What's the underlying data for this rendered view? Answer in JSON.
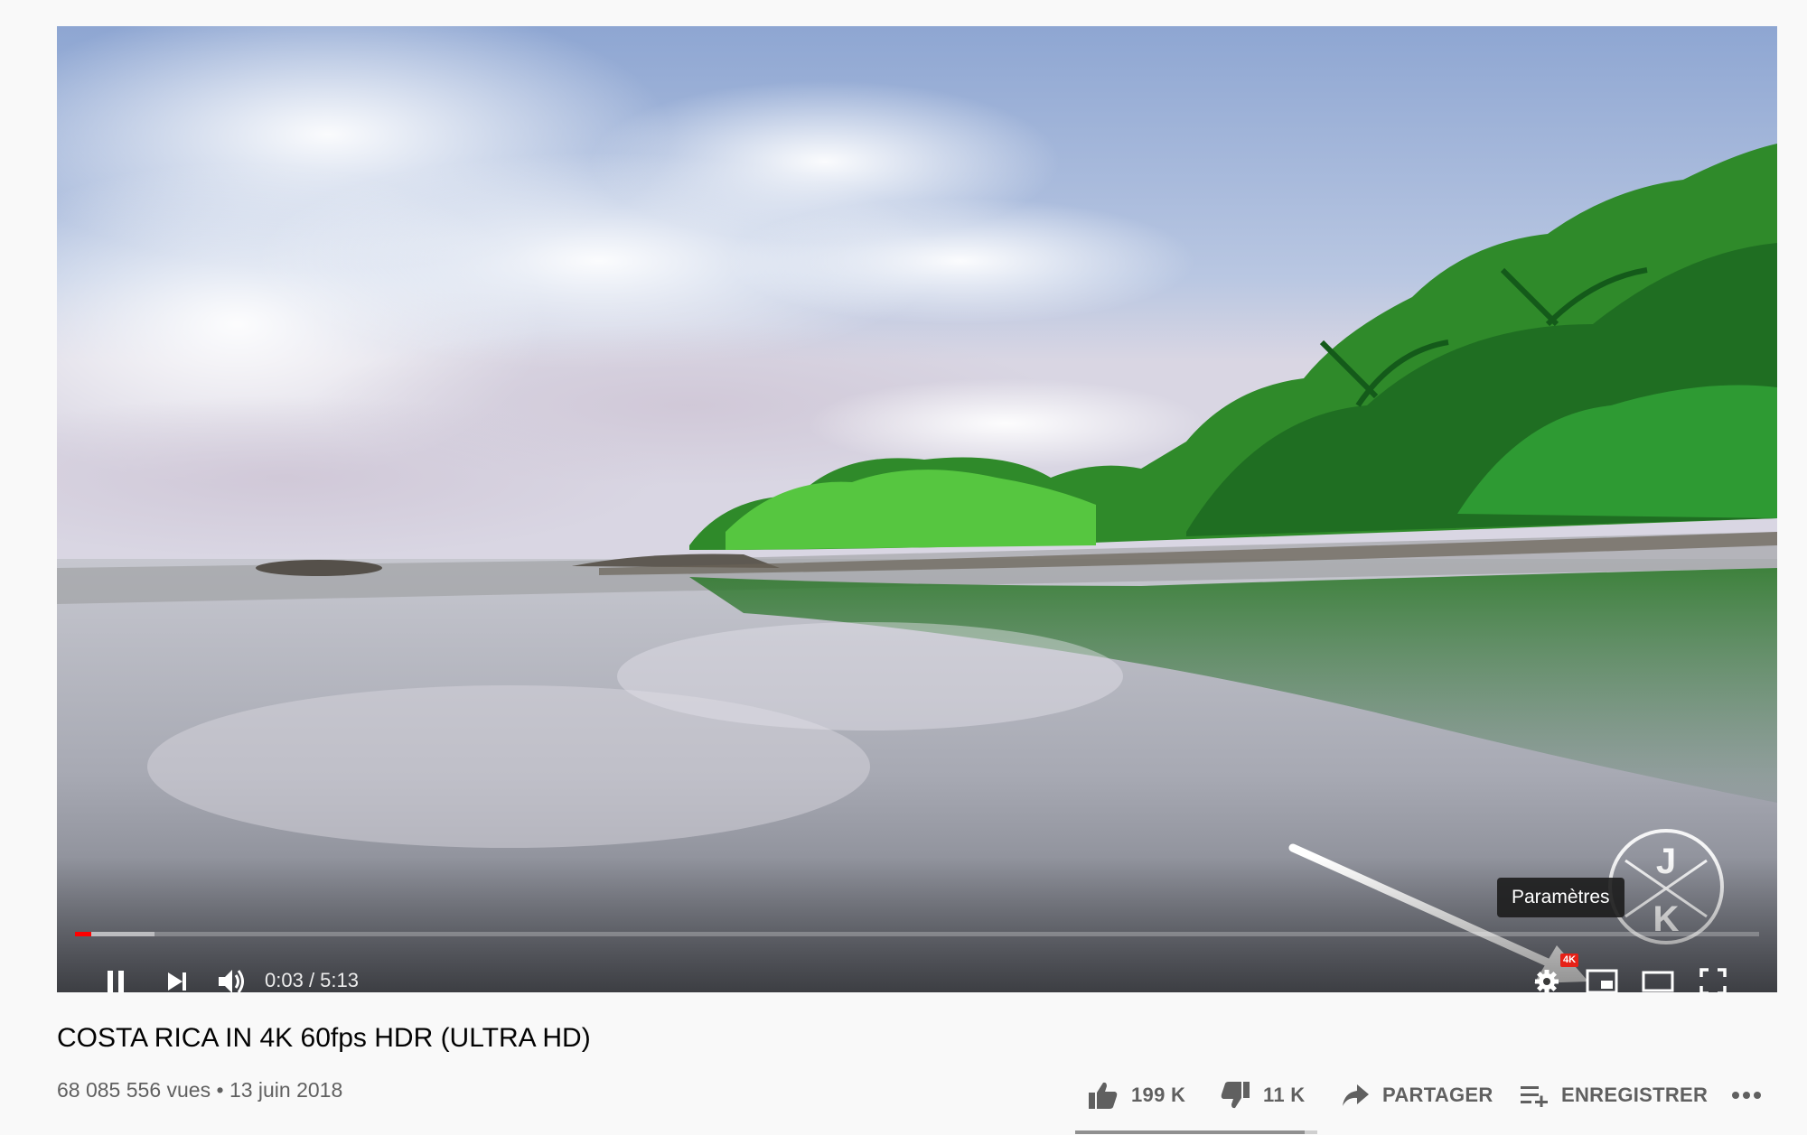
{
  "player": {
    "time_current": "0:03",
    "time_separator": " / ",
    "time_total": "5:13",
    "progress_fraction": 0.0096,
    "buffered_fraction": 0.047,
    "tooltip": "Paramètres",
    "quality_badge": "4K",
    "watermark_letters": [
      "J",
      "K"
    ],
    "controls": [
      "pause-icon",
      "next-icon",
      "volume-icon",
      "settings-icon",
      "miniplayer-icon",
      "theater-icon",
      "fullscreen-icon"
    ]
  },
  "video": {
    "title": "COSTA RICA IN 4K 60fps HDR (ULTRA HD)",
    "views": "68 085 556 vues",
    "separator": " • ",
    "date": "13 juin 2018"
  },
  "actions": {
    "like_count": "199 K",
    "dislike_count": "11 K",
    "share_label": "PARTAGER",
    "save_label": "ENREGISTRER",
    "more_icon": "more-horizontal-icon",
    "like_ratio": 0.948
  },
  "colors": {
    "progress_played": "#ff0000",
    "badge": "#e62117",
    "text_primary": "#030303",
    "text_secondary": "#606060"
  }
}
